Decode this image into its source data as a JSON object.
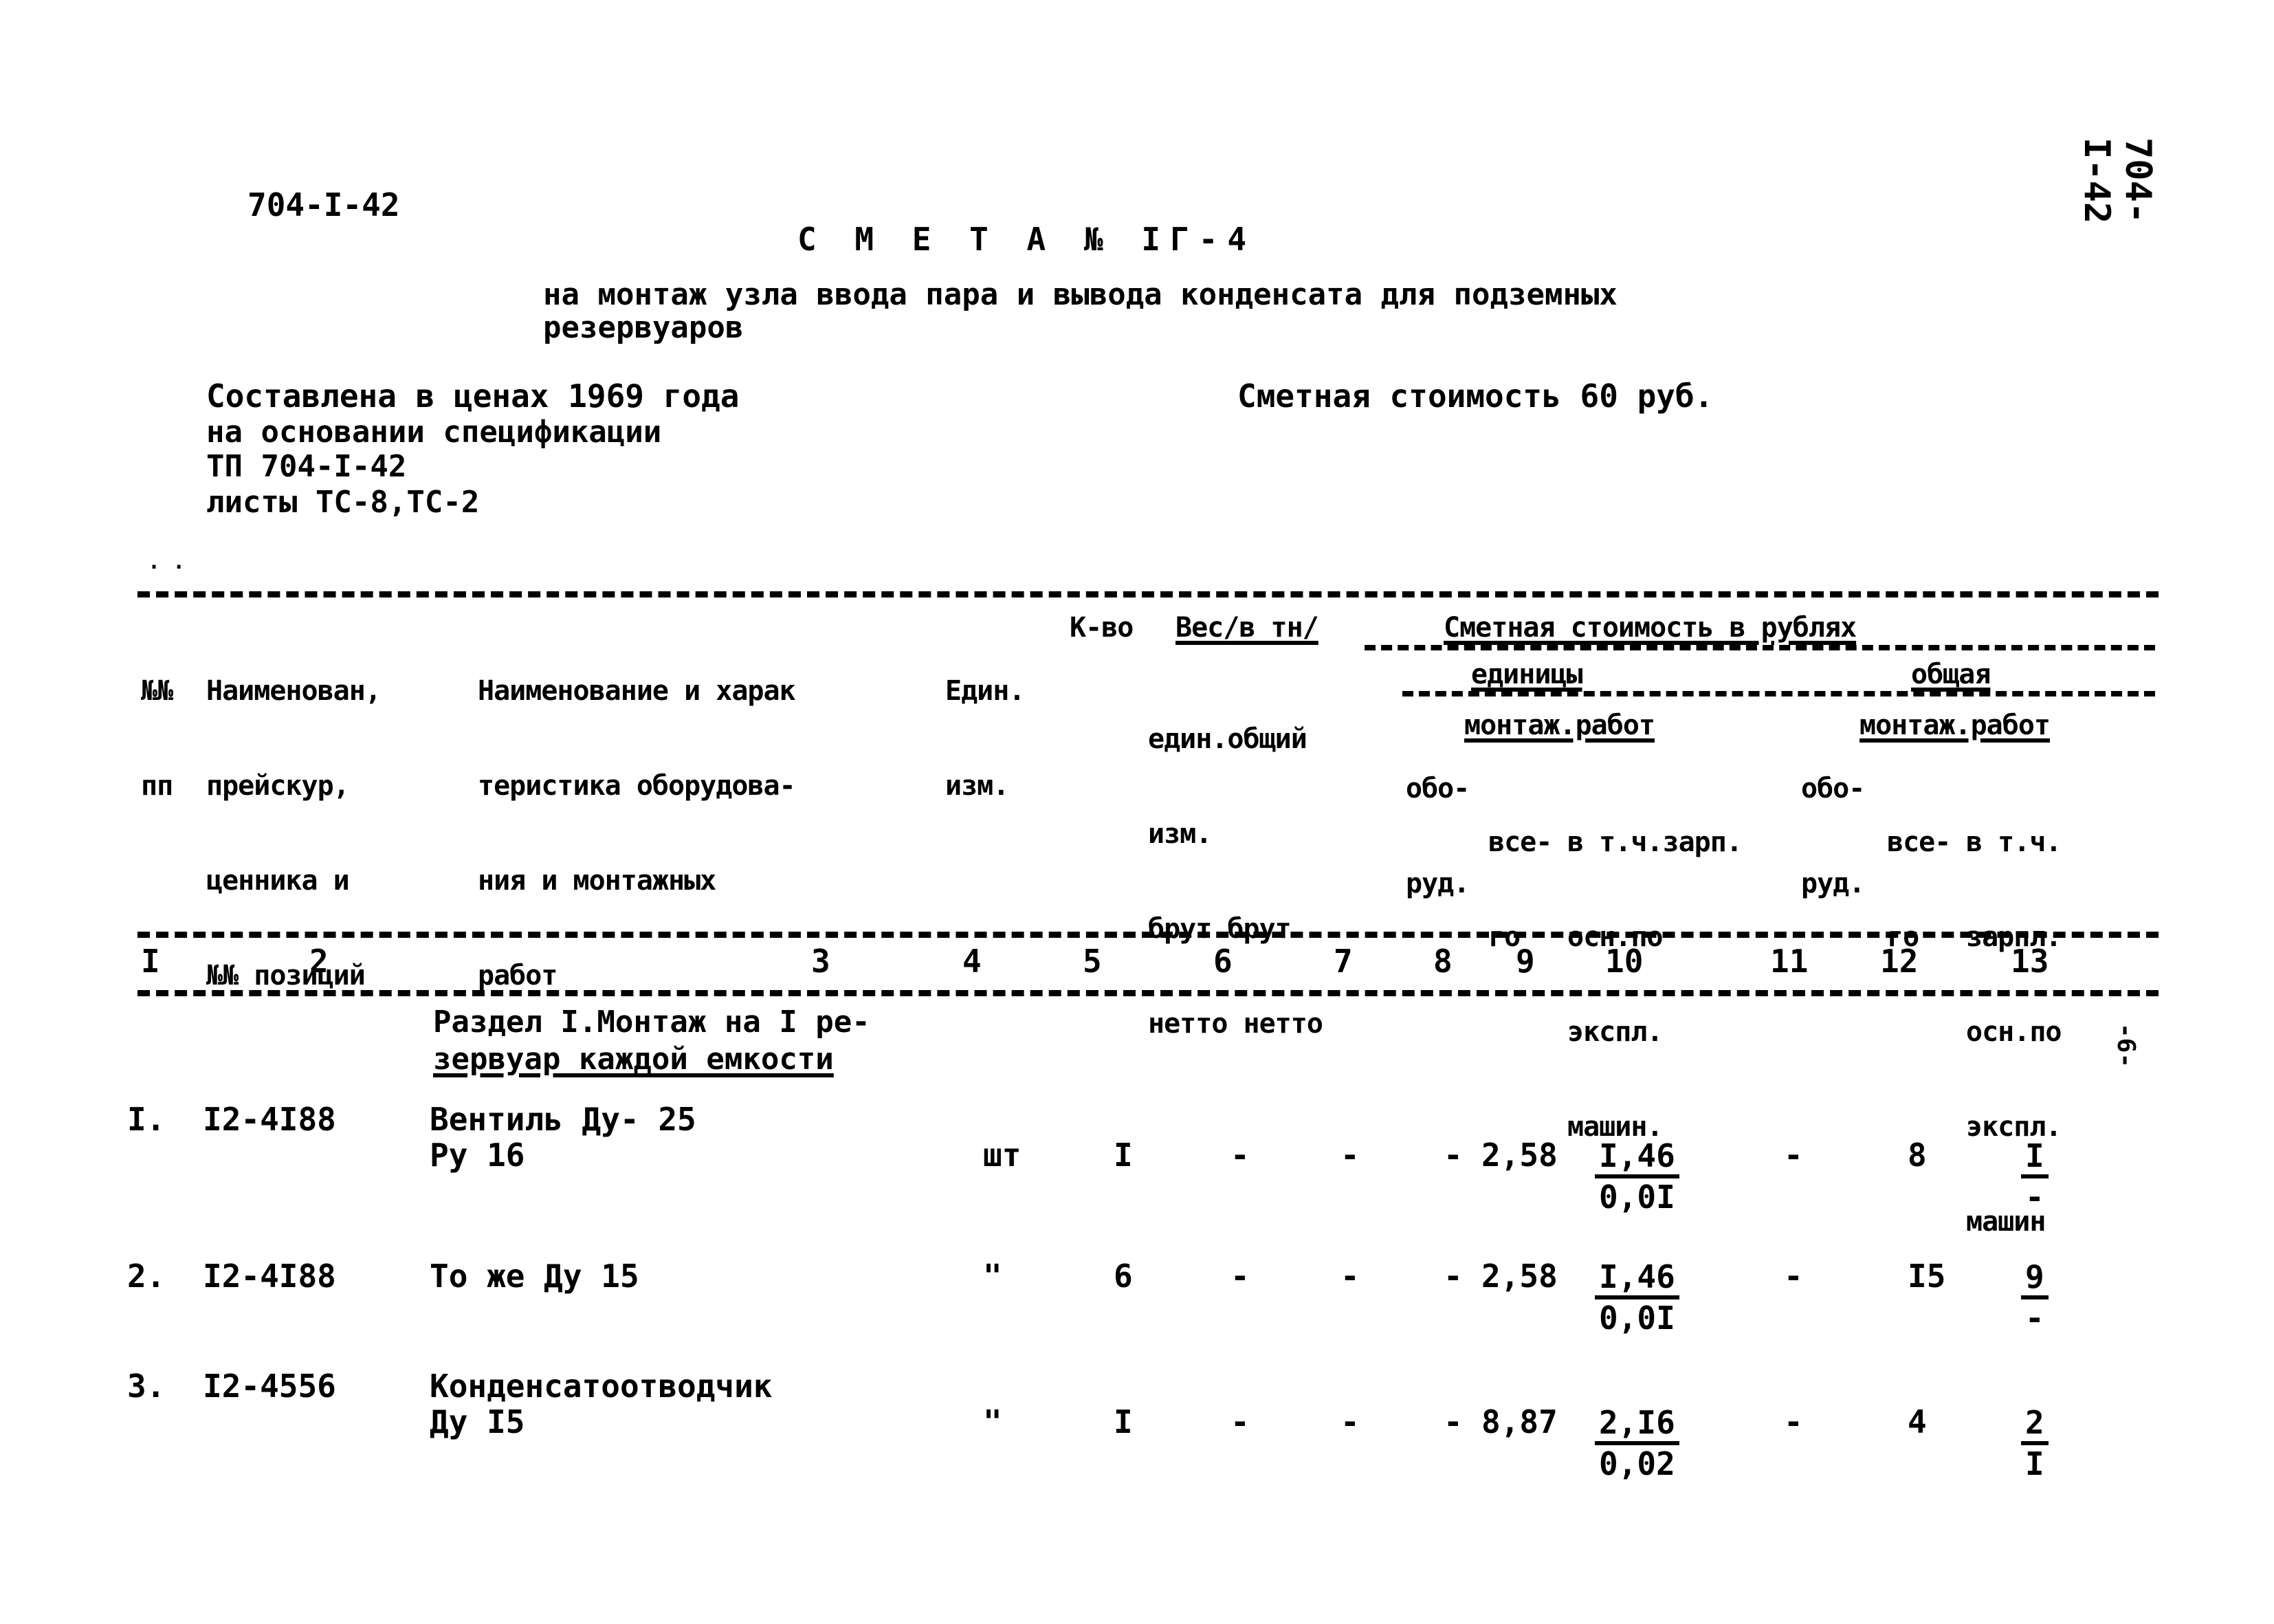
{
  "doc_code_top_left": "704-I-42",
  "doc_code_right_margin": "704-I-42",
  "title": "С М Е Т А № IГ-4",
  "subtitle_line1": "на монтаж узла ввода пара и вывода конденсата для подземных",
  "subtitle_line2": "резервуаров",
  "basis": {
    "line1": "Составлена в ценах 1969 года",
    "line2": "на основании спецификации",
    "line3": "ТП 704-I-42",
    "line4": "листы ТС-8,ТС-2"
  },
  "estimated_cost": "Сметная стоимость 60 руб.",
  "page_marker": "-6-",
  "table": {
    "headers": {
      "col1": [
        "№№",
        "пп"
      ],
      "col2": [
        "Наименован,",
        "прейскур,",
        "ценника и",
        "№№ позиций"
      ],
      "col3": [
        "Наименование и харак",
        "теристика оборудова-",
        "ния и монтажных",
        "работ"
      ],
      "col4": [
        "Един.",
        "изм."
      ],
      "col5": "К-во",
      "weight_group": "Вес/в тн/",
      "weight_sub": [
        "един.общий",
        "изм.",
        "брут.брут.",
        "нетто нетто"
      ],
      "cost_group": "Сметная стоимость в рублях",
      "unit_group": "единицы",
      "total_group": "общая",
      "equip": [
        "обо-",
        "руд."
      ],
      "mount_group": "монтаж.работ",
      "total_word": [
        "все-",
        "го"
      ],
      "unit_wage": [
        "в т.ч.зарп.",
        "осн.по",
        "экспл.",
        "машин."
      ],
      "total_wage": [
        "в т.ч.",
        "зарпл.",
        "осн.по",
        "экспл.",
        "машин"
      ]
    },
    "column_numbers": [
      "I",
      "2",
      "3",
      "4",
      "5",
      "6",
      "7",
      "8",
      "9",
      "10",
      "11",
      "12",
      "13"
    ],
    "section_title_line1": "Раздел I.Монтаж на I ре-",
    "section_title_line2": "зервуар каждой емкости",
    "rows": [
      {
        "num": "I.",
        "code": "I2-4I88",
        "name_line1": "Вентиль Ду- 25",
        "name_line2": "Ру 16",
        "unit": "шт",
        "qty": "I",
        "weight_unit": "-",
        "weight_total": "-",
        "unit_equip": "-",
        "unit_mount_total": "2,58",
        "unit_wage": "I,46",
        "unit_machine": "0,0I",
        "total_equip": "-",
        "total_mount": "8",
        "total_wage": "I",
        "total_machine": "-"
      },
      {
        "num": "2.",
        "code": "I2-4I88",
        "name_line1": "То же Ду 15",
        "name_line2": "",
        "unit": "\"",
        "qty": "6",
        "weight_unit": "-",
        "weight_total": "-",
        "unit_equip": "-",
        "unit_mount_total": "2,58",
        "unit_wage": "I,46",
        "unit_machine": "0,0I",
        "total_equip": "-",
        "total_mount": "I5",
        "total_wage": "9",
        "total_machine": "-"
      },
      {
        "num": "3.",
        "code": "I2-4556",
        "name_line1": "Конденсатоотводчик",
        "name_line2": "Ду I5",
        "unit": "\"",
        "qty": "I",
        "weight_unit": "-",
        "weight_total": "-",
        "unit_equip": "-",
        "unit_mount_total": "8,87",
        "unit_wage": "2,I6",
        "unit_machine": "0,02",
        "total_equip": "-",
        "total_mount": "4",
        "total_wage": "2",
        "total_machine": "I"
      }
    ]
  }
}
